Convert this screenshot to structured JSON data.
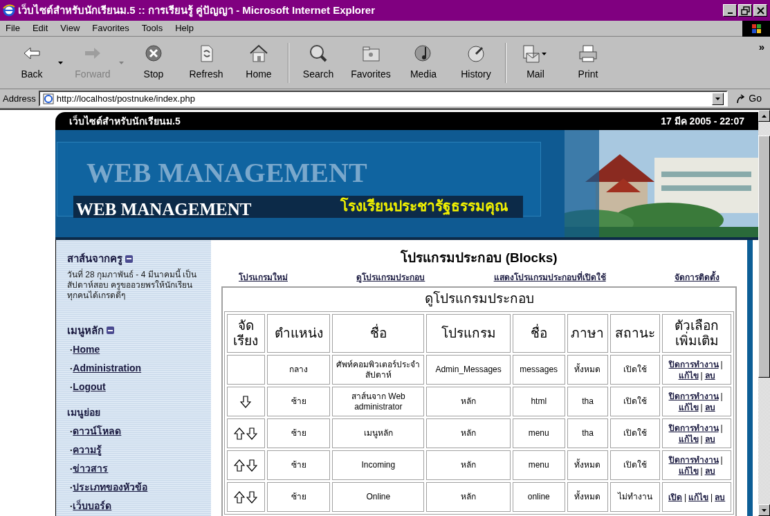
{
  "window": {
    "title": "เว็บไซต์สำหรับนักเรียนม.5 :: การเรียนรู้ คู่ปัญญา - Microsoft Internet Explorer"
  },
  "menu": [
    "File",
    "Edit",
    "View",
    "Favorites",
    "Tools",
    "Help"
  ],
  "toolbar": [
    {
      "label": "Back",
      "kind": "back",
      "disabled": false,
      "dropdown": true
    },
    {
      "label": "Forward",
      "kind": "forward",
      "disabled": true,
      "dropdown": true
    },
    {
      "label": "Stop",
      "kind": "stop",
      "disabled": false,
      "dropdown": false
    },
    {
      "label": "Refresh",
      "kind": "refresh",
      "disabled": false,
      "dropdown": false
    },
    {
      "label": "Home",
      "kind": "home",
      "disabled": false,
      "dropdown": false
    },
    {
      "label": "Search",
      "kind": "search",
      "disabled": false,
      "dropdown": false
    },
    {
      "label": "Favorites",
      "kind": "favorites",
      "disabled": false,
      "dropdown": false
    },
    {
      "label": "Media",
      "kind": "media",
      "disabled": false,
      "dropdown": false
    },
    {
      "label": "History",
      "kind": "history",
      "disabled": false,
      "dropdown": false
    },
    {
      "label": "Mail",
      "kind": "mail",
      "disabled": false,
      "dropdown": true
    },
    {
      "label": "Print",
      "kind": "print",
      "disabled": false,
      "dropdown": false
    }
  ],
  "toolbar_more": "»",
  "address": {
    "label": "Address",
    "value": "http://localhost/postnuke/index.php",
    "go": "Go"
  },
  "site_header": {
    "site_name": "เว็บไซต์สำหรับนักเรียนม.5",
    "date": "17 มีค 2005 - 22:07"
  },
  "banner": {
    "background_text": "WEB MANAGEMENT",
    "title": "WEB MANAGEMENT",
    "school": "โรงเรียนประชารัฐธรรมคุณ"
  },
  "sidebar": {
    "message_block": {
      "title": "สาส์นจากครู",
      "text": "วันที่ 28 กุมภาพันธ์ - 4 มีนาคมนี้ เป็นสัปดาห์สอบ ครูขออวยพรให้นักเรียนทุกคนได้เกรดดีๆ"
    },
    "main_menu": {
      "title": "เมนูหลัก",
      "items": [
        {
          "bullet": "·",
          "label": "Home"
        },
        {
          "bullet": "·",
          "label": "Administration"
        },
        {
          "bullet": "·",
          "label": "Logout"
        }
      ]
    },
    "sub_menu": {
      "title": "เมนูย่อย",
      "items": [
        {
          "bullet": "·",
          "label": "ดาวน์โหลด"
        },
        {
          "bullet": "·",
          "label": "ความรู้"
        },
        {
          "bullet": "·",
          "label": "ข่าวสาร"
        },
        {
          "bullet": "·",
          "label": "ประเภทของหัวข้อ"
        },
        {
          "bullet": "·",
          "label": "เว็บบอร์ด"
        }
      ]
    }
  },
  "main": {
    "heading": "โปรแกรมประกอบ (Blocks)",
    "links": [
      "โปรแกรมใหม่",
      "ดูโปรแกรมประกอบ",
      "แสดงโปรแกรมประกอบที่เปิดใช้",
      "จัดการติดตั้ง"
    ],
    "table": {
      "title": "ดูโปรแกรมประกอบ",
      "columns": [
        "จัด เรียง",
        "ตำแหน่ง",
        "ชื่อ",
        "โปรแกรม",
        "ชื่อ",
        "ภาษา",
        "สถานะ",
        "ตัวเลือก เพิ่มเติม"
      ],
      "rows": [
        {
          "move_up": false,
          "move_down": false,
          "position": "กลาง",
          "title": "ศัพท์คอมพิวเตอร์ประจำสัปดาห์",
          "module": "Admin_Messages",
          "name": "messages",
          "language": "ทั้งหมด",
          "status": "เปิดใช้",
          "actions": [
            {
              "kind": "link",
              "label": "ปิดการทำงาน"
            },
            {
              "kind": "sep",
              "label": "|"
            },
            {
              "kind": "link",
              "label": "แก้ไข"
            },
            {
              "kind": "sep",
              "label": "|"
            },
            {
              "kind": "link",
              "label": "ลบ"
            }
          ]
        },
        {
          "move_up": false,
          "move_down": true,
          "position": "ซ้าย",
          "title": "สาส์นจาก Web administrator",
          "module": "หลัก",
          "name": "html",
          "language": "tha",
          "status": "เปิดใช้",
          "actions": [
            {
              "kind": "link",
              "label": "ปิดการทำงาน"
            },
            {
              "kind": "sep",
              "label": "|"
            },
            {
              "kind": "link",
              "label": "แก้ไข"
            },
            {
              "kind": "sep",
              "label": "|"
            },
            {
              "kind": "link",
              "label": "ลบ"
            }
          ]
        },
        {
          "move_up": true,
          "move_down": true,
          "position": "ซ้าย",
          "title": "เมนูหลัก",
          "module": "หลัก",
          "name": "menu",
          "language": "tha",
          "status": "เปิดใช้",
          "actions": [
            {
              "kind": "link",
              "label": "ปิดการทำงาน"
            },
            {
              "kind": "sep",
              "label": "|"
            },
            {
              "kind": "link",
              "label": "แก้ไข"
            },
            {
              "kind": "sep",
              "label": "|"
            },
            {
              "kind": "link",
              "label": "ลบ"
            }
          ]
        },
        {
          "move_up": true,
          "move_down": true,
          "position": "ซ้าย",
          "title": "Incoming",
          "module": "หลัก",
          "name": "menu",
          "language": "ทั้งหมด",
          "status": "เปิดใช้",
          "actions": [
            {
              "kind": "link",
              "label": "ปิดการทำงาน"
            },
            {
              "kind": "sep",
              "label": "|"
            },
            {
              "kind": "link",
              "label": "แก้ไข"
            },
            {
              "kind": "sep",
              "label": "|"
            },
            {
              "kind": "link",
              "label": "ลบ"
            }
          ]
        },
        {
          "move_up": true,
          "move_down": true,
          "position": "ซ้าย",
          "title": "Online",
          "module": "หลัก",
          "name": "online",
          "language": "ทั้งหมด",
          "status": "ไม่ทำงาน",
          "actions": [
            {
              "kind": "link",
              "label": "เปิด"
            },
            {
              "kind": "sep",
              "label": "|"
            },
            {
              "kind": "link",
              "label": "แก้ไข"
            },
            {
              "kind": "sep",
              "label": "|"
            },
            {
              "kind": "link",
              "label": "ลบ"
            }
          ]
        }
      ]
    }
  }
}
